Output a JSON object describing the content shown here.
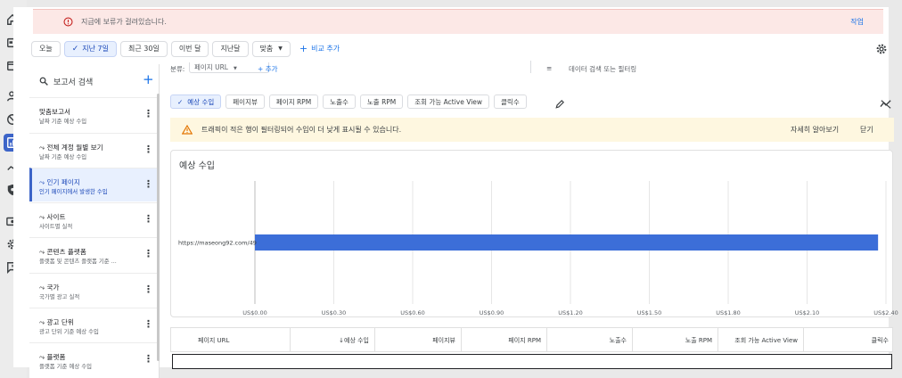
{
  "alert": {
    "text": "지급에 보류가 걸려있습니다.",
    "action": "작업"
  },
  "date_toolbar": {
    "chips": [
      "오늘",
      "지난 7일",
      "최근 30일",
      "이번 달",
      "지난달",
      "맞춤"
    ],
    "selected_index": 1,
    "compare_label": "비교 추가"
  },
  "sidebar": {
    "search_placeholder": "보고서 검색",
    "items": [
      {
        "title": "맞춤보고서",
        "subtitle": "날짜 기준 예상 수입",
        "trend": false
      },
      {
        "title": "전체 계정 월별 보기",
        "subtitle": "날짜 기준 예상 수입",
        "trend": true
      },
      {
        "title": "인기 페이지",
        "subtitle": "인기 페이지에서 발생한 수입",
        "trend": true,
        "active": true
      },
      {
        "title": "사이트",
        "subtitle": "사이트별 실적",
        "trend": true
      },
      {
        "title": "콘텐츠 플랫폼",
        "subtitle": "플랫폼 및 콘텐츠 플랫폼 기준 ...",
        "trend": true
      },
      {
        "title": "국가",
        "subtitle": "국가별 광고 실적",
        "trend": true
      },
      {
        "title": "광고 단위",
        "subtitle": "광고 단위 기준 예상 수입",
        "trend": true
      },
      {
        "title": "플랫폼",
        "subtitle": "플랫폼 기준 예상 수입",
        "trend": true
      }
    ]
  },
  "filter_row": {
    "label": "분류:",
    "dimension": "페이지 URL",
    "add_label": "추가",
    "search_placeholder": "데이터 검색 또는 필터링"
  },
  "metric_chips": [
    "예상 수입",
    "페이지뷰",
    "페이지 RPM",
    "노출수",
    "노출 RPM",
    "조회 가능 Active View",
    "클릭수"
  ],
  "selected_metric_index": 0,
  "warning": {
    "text": "트래픽이 적은 행이 필터링되어 수입이 더 낮게 표시될 수 있습니다.",
    "learn_more": "자세히 알아보기",
    "close": "닫기"
  },
  "chart_data": {
    "type": "bar",
    "orientation": "horizontal",
    "title": "예상 수입",
    "categories": [
      "https://maseong92.com/49"
    ],
    "values": [
      2.37
    ],
    "xlim": [
      0,
      2.4
    ],
    "x_ticks": [
      0,
      0.3,
      0.6,
      0.9,
      1.2,
      1.5,
      1.8,
      2.1,
      2.4
    ],
    "tick_labels": [
      "US$0.00",
      "US$0.30",
      "US$0.60",
      "US$0.90",
      "US$1.20",
      "US$1.50",
      "US$1.80",
      "US$2.10",
      "US$2.40"
    ],
    "grid": true,
    "bar_color": "#3c6ed8"
  },
  "table": {
    "columns": [
      "페이지 URL",
      "예상 수입",
      "페이지뷰",
      "페이지 RPM",
      "노출수",
      "노출 RPM",
      "조회 가능 Active View",
      "클릭수"
    ],
    "sort_indicator": "↓"
  }
}
